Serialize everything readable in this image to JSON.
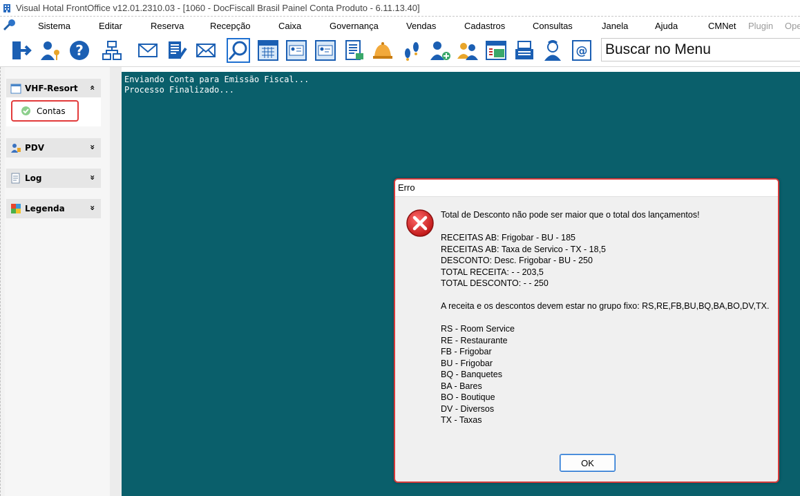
{
  "window": {
    "title": "Visual Hotal FrontOffice v12.01.2310.03 - [1060 - DocFiscall Brasil Painel Conta Produto - 6.11.13.40]"
  },
  "menubar": {
    "items": [
      "Sistema",
      "Editar",
      "Reserva",
      "Recepção",
      "Caixa",
      "Governança",
      "Vendas",
      "Cadastros",
      "Consultas",
      "Janela",
      "Ajuda",
      "CMNet",
      "Plugin",
      "Ope"
    ]
  },
  "toolbar": {
    "search_text": "Buscar no Menu",
    "icons": [
      "exit-icon",
      "user-key-icon",
      "help-icon",
      "network-icon",
      "mail-icon",
      "document-edit-icon",
      "mail-send-icon",
      "search-icon",
      "calendar-icon",
      "card-icon",
      "id-card-icon",
      "report-icon",
      "bell-icon",
      "footprints-icon",
      "add-guest-icon",
      "guests-icon",
      "cashier-icon",
      "register-icon",
      "housekeeper-icon",
      "email-at-icon"
    ]
  },
  "sidebar": {
    "groups": [
      {
        "label": "VHF-Resort",
        "chevron": "«",
        "items": [
          {
            "label": "Contas"
          }
        ]
      },
      {
        "label": "PDV",
        "chevron": "»"
      },
      {
        "label": "Log",
        "chevron": "»"
      },
      {
        "label": "Legenda",
        "chevron": "»"
      }
    ]
  },
  "console": {
    "lines": [
      "Enviando Conta para Emissão Fiscal...",
      "Processo Finalizado..."
    ]
  },
  "dialog": {
    "title": "Erro",
    "message": {
      "headline": "Total de Desconto não pode ser maior que o total dos lançamentos!",
      "entries": [
        "RECEITAS AB: Frigobar - BU - 185",
        "RECEITAS AB: Taxa de Servico - TX - 18,5",
        "DESCONTO: Desc. Frigobar - BU - 250",
        "TOTAL RECEITA:  -  - 203,5",
        "TOTAL DESCONTO:  -  - 250"
      ],
      "rule": "A receita e os descontos devem estar no grupo fixo: RS,RE,FB,BU,BQ,BA,BO,DV,TX.",
      "groups": [
        "RS - Room Service",
        "RE - Restaurante",
        "FB - Frigobar",
        "BU - Frigobar",
        "BQ - Banquetes",
        "BA - Bares",
        "BO - Boutique",
        "DV - Diversos",
        "TX - Taxas"
      ]
    },
    "ok_label": "OK"
  },
  "colors": {
    "main_background": "#0a5f6b",
    "highlight_border": "#e23a3a",
    "dialog_border": "#d73a3a",
    "button_focus": "#1f6fcf"
  }
}
